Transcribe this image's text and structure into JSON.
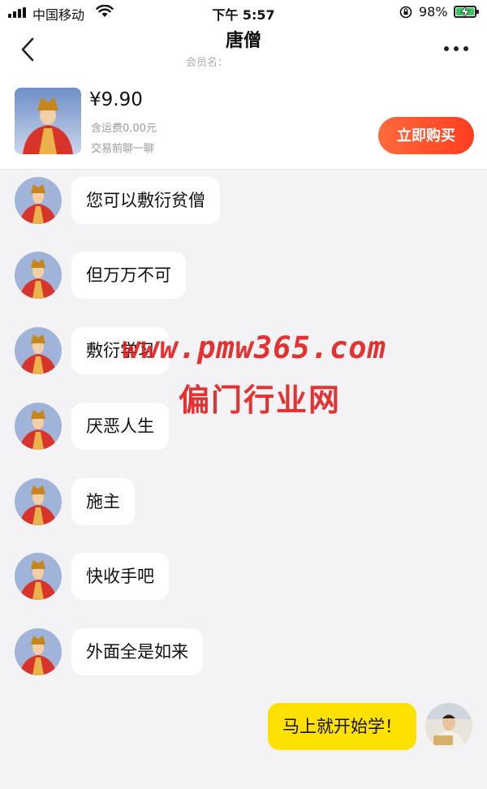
{
  "status_bar": {
    "carrier": "中国移动",
    "time": "下午 5:57",
    "battery_percent": "98%",
    "battery_level": 0.98,
    "icons": [
      "signal-icon",
      "wifi-icon",
      "orientation-lock-icon",
      "battery-charging-icon"
    ]
  },
  "nav": {
    "title": "唐僧",
    "member_label": "会员名：",
    "member_value": ""
  },
  "product": {
    "price": "¥9.90",
    "shipping": "含运费0.00元",
    "hint": "交易前聊一聊",
    "buy_label": "立即购买"
  },
  "messages": [
    {
      "text": "您可以敷衍贫僧",
      "sender": "other"
    },
    {
      "text": "但万万不可",
      "sender": "other"
    },
    {
      "text": "敷衍学习",
      "sender": "other"
    },
    {
      "text": "厌恶人生",
      "sender": "other"
    },
    {
      "text": "施主",
      "sender": "other"
    },
    {
      "text": "快收手吧",
      "sender": "other"
    },
    {
      "text": "外面全是如来",
      "sender": "other"
    },
    {
      "text": "马上就开始学！",
      "sender": "self"
    }
  ],
  "watermark": {
    "url": "www.pmw365.com",
    "name": "偏门行业网"
  },
  "colors": {
    "buy_button": "#ff4a26",
    "self_bubble": "#ffe100",
    "background": "#f3f2f5",
    "watermark": "#e41616",
    "battery": "#35c759"
  }
}
